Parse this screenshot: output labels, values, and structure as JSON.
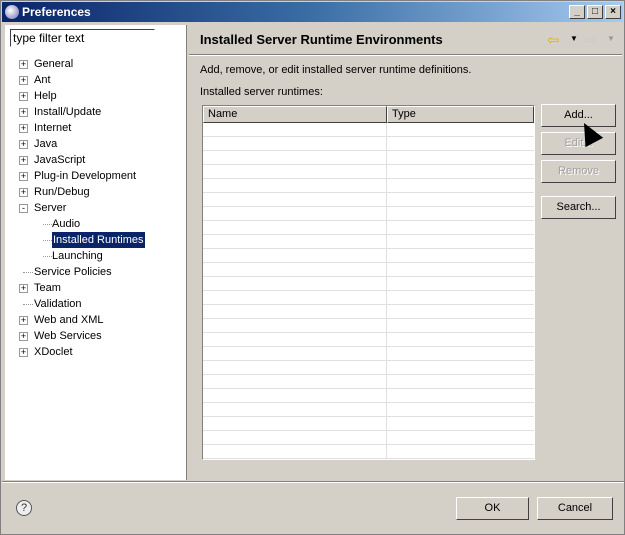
{
  "window": {
    "title": "Preferences",
    "minimize": "_",
    "maximize": "□",
    "close": "×"
  },
  "filter": {
    "placeholder": "type filter text",
    "value": "type filter text"
  },
  "tree": [
    {
      "label": "General",
      "expander": "+",
      "level": 0
    },
    {
      "label": "Ant",
      "expander": "+",
      "level": 0
    },
    {
      "label": "Help",
      "expander": "+",
      "level": 0
    },
    {
      "label": "Install/Update",
      "expander": "+",
      "level": 0
    },
    {
      "label": "Internet",
      "expander": "+",
      "level": 0
    },
    {
      "label": "Java",
      "expander": "+",
      "level": 0
    },
    {
      "label": "JavaScript",
      "expander": "+",
      "level": 0
    },
    {
      "label": "Plug-in Development",
      "expander": "+",
      "level": 0
    },
    {
      "label": "Run/Debug",
      "expander": "+",
      "level": 0
    },
    {
      "label": "Server",
      "expander": "-",
      "level": 0
    },
    {
      "label": "Audio",
      "expander": "",
      "level": 1
    },
    {
      "label": "Installed Runtimes",
      "expander": "",
      "level": 1,
      "selected": true
    },
    {
      "label": "Launching",
      "expander": "",
      "level": 1
    },
    {
      "label": "Service Policies",
      "expander": "",
      "level": 0
    },
    {
      "label": "Team",
      "expander": "+",
      "level": 0
    },
    {
      "label": "Validation",
      "expander": "",
      "level": 0
    },
    {
      "label": "Web and XML",
      "expander": "+",
      "level": 0
    },
    {
      "label": "Web Services",
      "expander": "+",
      "level": 0
    },
    {
      "label": "XDoclet",
      "expander": "+",
      "level": 0
    }
  ],
  "page": {
    "title": "Installed Server Runtime Environments",
    "description": "Add, remove, or edit installed server runtime definitions.",
    "list_label": "Installed server runtimes:",
    "columns": [
      "Name",
      "Type"
    ],
    "buttons": {
      "add": "Add...",
      "edit": "Edit...",
      "remove": "Remove",
      "search": "Search..."
    }
  },
  "footer": {
    "help": "?",
    "ok": "OK",
    "cancel": "Cancel"
  }
}
